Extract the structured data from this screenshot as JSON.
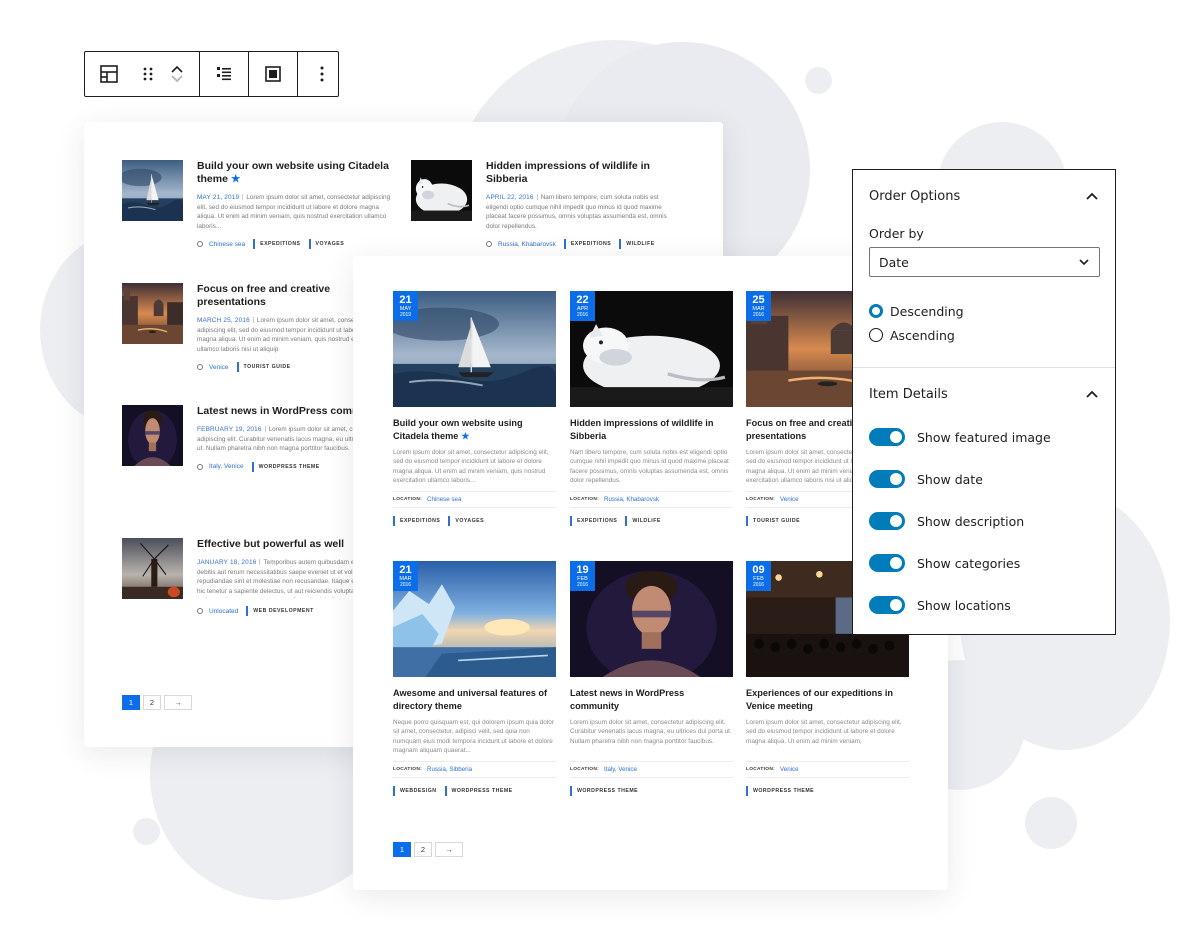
{
  "toolbar": {
    "icons": [
      "block-layout-icon",
      "drag-handle-icon",
      "move-up-icon",
      "move-down-icon",
      "list-view-icon",
      "align-icon",
      "more-options-icon"
    ]
  },
  "list_card": {
    "items": [
      {
        "title": "Build your own website using Citadela theme",
        "starred": true,
        "date": "MAY 21, 2019",
        "excerpt": "Lorem ipsum dolor sit amet, consectetur adipiscing elit, sed do eiusmod tempor incididunt ut labore et dolore magna aliqua. Ut enim ad minim veniam, quis nostrud exercitation ullamco laboris...",
        "location": "Chinese sea",
        "tags": [
          "EXPEDITIONS",
          "VOYAGES"
        ]
      },
      {
        "title": "Hidden impressions of wildlife in Sibberia",
        "starred": false,
        "date": "APRIL 22, 2016",
        "excerpt": "Nam libero tempore, cum soluta nobis est eligendi optio cumque nihil impedit quo minus id quod maxime placeat facere possimus, omnis voluptas assumenda est, omnis dolor repellendus.",
        "location": "Russia, Khabarovsk",
        "tags": [
          "EXPEDITIONS",
          "WILDLIFE"
        ]
      },
      {
        "title": "Focus on free and creative presentations",
        "starred": false,
        "date": "MARCH 25, 2016",
        "excerpt": "Lorem ipsum dolor sit amet, consectetur adipiscing elit, sed do eiusmod tempor incididunt ut labore et dolore magna aliqua. Ut enim ad minim veniam, quis nostrud exercitation ullamco laboris nisi ut aliquip",
        "location": "Venice",
        "tags": [
          "TOURIST GUIDE"
        ]
      },
      {
        "title": "Latest news in WordPress community",
        "starred": false,
        "date": "FEBRUARY 19, 2016",
        "excerpt": "Lorem ipsum dolor sit amet, consectetur adipiscing elit. Curabitur venenatis lacus magna, eu ultrices dui porta ut. Nullam pharetra nibh non magna porttitor faucibus.",
        "location": "Italy, Venice",
        "tags": [
          "WORDPRESS THEME"
        ]
      },
      {
        "title": "Effective but powerful as well",
        "starred": false,
        "date": "JANUARY 18, 2016",
        "excerpt": "Temporibus autem quibusdam et aut officiis debitis aut rerum necessitatibus saepe eveniet ut et voluptates repudiandae sint et molestiae non recusandae. Itaque earum rerum hic tenetur a sapiente delectus, ut aut reiciendis voluptatibus maiores alias consequatur aut perferendis doloribus asperiores repellat. Lorem ipsum dolor sit amet quibusdam et aut officiis Lorem ipsum dolor sit",
        "location": "Unlocated",
        "tags": [
          "WEB DEVELOPMENT"
        ]
      }
    ],
    "pagination": {
      "pages": [
        "1",
        "2"
      ],
      "next": "→",
      "current": "1"
    }
  },
  "grid_card": {
    "location_label": "LOCATION:",
    "items": [
      {
        "day": "21",
        "month": "MAY",
        "year": "2019",
        "title": "Build your own website using Citadela theme",
        "starred": true,
        "excerpt": "Lorem ipsum dolor sit amet, consectetur adipiscing elit, sed do eiusmod tempor incididunt ut labore et dolore magna aliqua. Ut enim ad minim veniam, quis nostrud exercitation ullamco laboris...",
        "location": "Chinese sea",
        "tags": [
          "EXPEDITIONS",
          "VOYAGES"
        ]
      },
      {
        "day": "22",
        "month": "APR",
        "year": "2016",
        "title": "Hidden impressions of wildlife in Sibberia",
        "starred": false,
        "excerpt": "Nam libero tempore, cum soluta nobis est eligendi optio cumque nihil impedit quo minus id quod maxime placeat facere possimus, omnis voluptas assumenda est, omnis dolor repellendus.",
        "location": "Russia, Khabarovsk",
        "tags": [
          "EXPEDITIONS",
          "WILDLIFE"
        ]
      },
      {
        "day": "25",
        "month": "MAR",
        "year": "2016",
        "title": "Focus on free and creative presentations",
        "starred": false,
        "excerpt": "Lorem ipsum dolor sit amet, consectetur adipiscing elit, sed do eiusmod tempor incididunt ut labore et dolore magna aliqua. Ut enim ad minim veniam, quis nostrud exercitation ullamco laboris nisi ut aliquip",
        "location": "Venice",
        "tags": [
          "TOURIST GUIDE"
        ]
      },
      {
        "day": "21",
        "month": "MAR",
        "year": "2016",
        "title": "Awesome and universal features of directory theme",
        "starred": false,
        "excerpt": "Neque porro quisquam est, qui dolorem ipsum quia dolor sit amet, consectetur, adipisci velit, sed quia non numquam eius modi tempora incidunt ut labore et dolore magnam aliquam quaerat...",
        "location": "Russia, Sibberia",
        "tags": [
          "WEBDESIGN",
          "WORDPRESS THEME"
        ]
      },
      {
        "day": "19",
        "month": "FEB",
        "year": "2016",
        "title": "Latest news in WordPress community",
        "starred": false,
        "excerpt": "Lorem ipsum dolor sit amet, consectetur adipiscing elit. Curabitur venenatis lacus magna, eu ultrices dui porta ut. Nullam pharetra nibh non magna porttitor faucibus.",
        "location": "Italy, Venice",
        "tags": [
          "WORDPRESS THEME"
        ]
      },
      {
        "day": "09",
        "month": "FEB",
        "year": "2016",
        "title": "Experiences of our expeditions in Venice meeting",
        "starred": false,
        "excerpt": "Lorem ipsum dolor sit amet, consectetur adipiscing elit, sed do eiusmod tempor incididunt ut labore et dolore magna aliqua. Ut enim ad minim veniam,",
        "location": "Venice",
        "tags": [
          "WORDPRESS THEME"
        ]
      }
    ],
    "pagination": {
      "pages": [
        "1",
        "2"
      ],
      "next": "→",
      "current": "1"
    }
  },
  "panel": {
    "order_options": {
      "title": "Order Options",
      "order_by_label": "Order by",
      "order_by_value": "Date",
      "radios": [
        {
          "label": "Descending",
          "checked": true
        },
        {
          "label": "Ascending",
          "checked": false
        }
      ]
    },
    "item_details": {
      "title": "Item Details",
      "toggles": [
        {
          "label": "Show featured image",
          "on": true
        },
        {
          "label": "Show date",
          "on": true
        },
        {
          "label": "Show description",
          "on": true
        },
        {
          "label": "Show categories",
          "on": true
        },
        {
          "label": "Show locations",
          "on": true
        }
      ]
    }
  },
  "colors": {
    "accent": "#0b6ee8",
    "wp_blue": "#007cba",
    "link": "#2f6fcf",
    "blob": "#eceef2"
  }
}
